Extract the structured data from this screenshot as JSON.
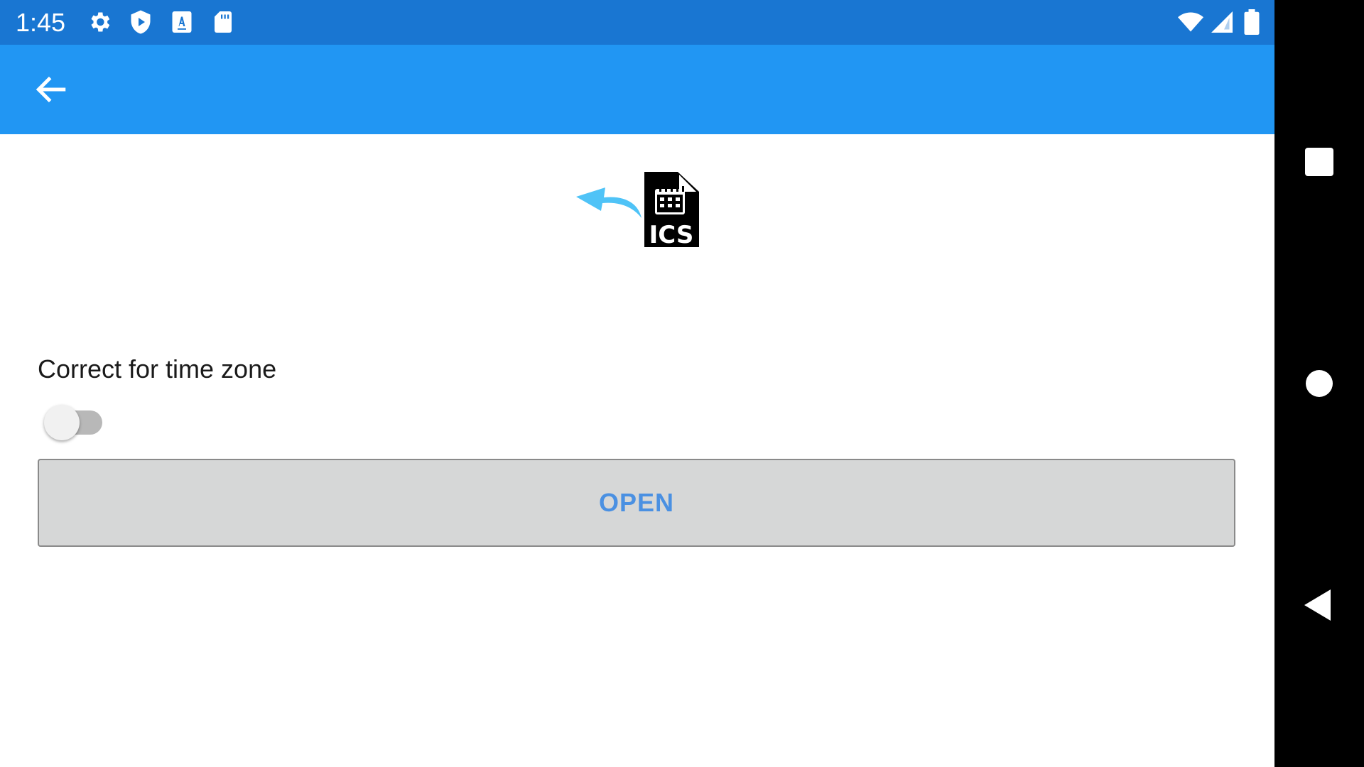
{
  "status_bar": {
    "time": "1:45",
    "icons": [
      "settings-icon",
      "play-shield-icon",
      "keyboard-a-icon",
      "sd-card-icon",
      "wifi-icon",
      "cell-signal-icon",
      "battery-icon"
    ],
    "background": "#1976D2"
  },
  "toolbar": {
    "back_icon": "arrow-back-icon",
    "background": "#2196F3"
  },
  "logo": {
    "text": "ICS",
    "icon": "ics-import-icon",
    "arrow_color": "#4FC3F7"
  },
  "settings": {
    "timezone_label": "Correct for time zone",
    "timezone_toggle_on": false
  },
  "open_button": {
    "label": "OPEN",
    "text_color": "#4a90e2"
  },
  "nav_bar": {
    "icons": [
      "recents-square-icon",
      "home-circle-icon",
      "back-triangle-icon"
    ]
  }
}
